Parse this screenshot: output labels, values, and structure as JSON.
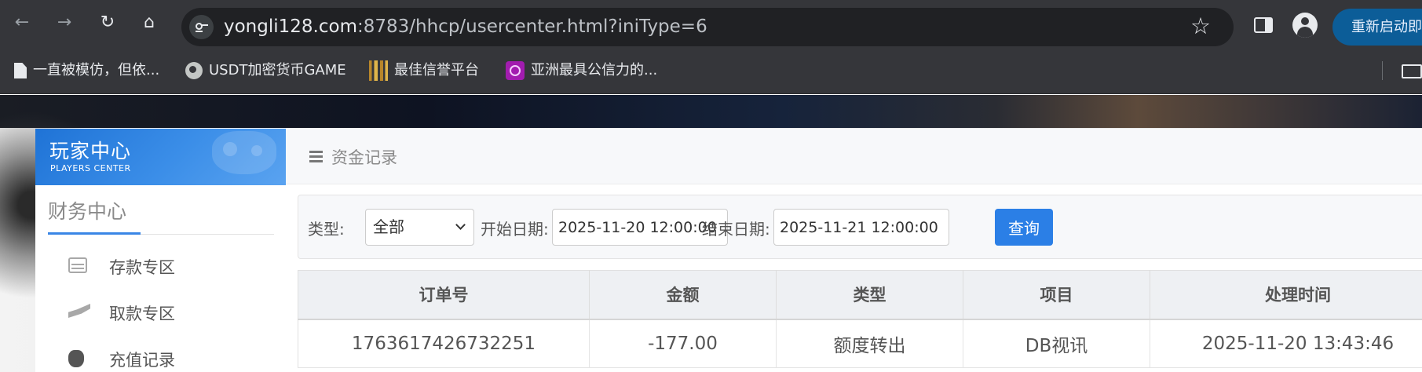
{
  "browser": {
    "url_host": "yongli128.com",
    "url_rest": ":8783/hhcp/usercenter.html?iniType=6",
    "relaunch_label": "重新启动即可更新",
    "bookmarks": [
      {
        "label": "一直被模仿，但依...",
        "icon": "document-icon"
      },
      {
        "label": "USDT加密货币GAME",
        "icon": "globe-icon"
      },
      {
        "label": "最佳信誉平台",
        "icon": "gold-logo-icon"
      },
      {
        "label": "亚洲最具公信力的...",
        "icon": "purple-logo-icon"
      }
    ]
  },
  "sidebar": {
    "logo_cn": "玩家中心",
    "logo_en": "PLAYERS CENTER",
    "section_title": "财务中心",
    "items": [
      {
        "label": "存款专区",
        "icon": "deposit-card-icon"
      },
      {
        "label": "取款专区",
        "icon": "withdraw-hand-icon"
      },
      {
        "label": "充值记录",
        "icon": "moneybag-icon"
      }
    ]
  },
  "main": {
    "breadcrumb": "资金记录",
    "filter": {
      "type_label": "类型:",
      "type_value": "全部",
      "start_label": "开始日期:",
      "start_value": "2025-11-20 12:00:00",
      "end_label": "结束日期:",
      "end_value": "2025-11-21 12:00:00",
      "query_label": "查询"
    },
    "table": {
      "headers": [
        "订单号",
        "金额",
        "类型",
        "项目",
        "处理时间"
      ],
      "rows": [
        [
          "1763617426732251",
          "-177.00",
          "额度转出",
          "DB视讯",
          "2025-11-20 13:43:46"
        ]
      ]
    }
  },
  "colors": {
    "accent": "#2b7fe6",
    "chrome": "#35363a",
    "relaunch": "#0c5d98"
  }
}
